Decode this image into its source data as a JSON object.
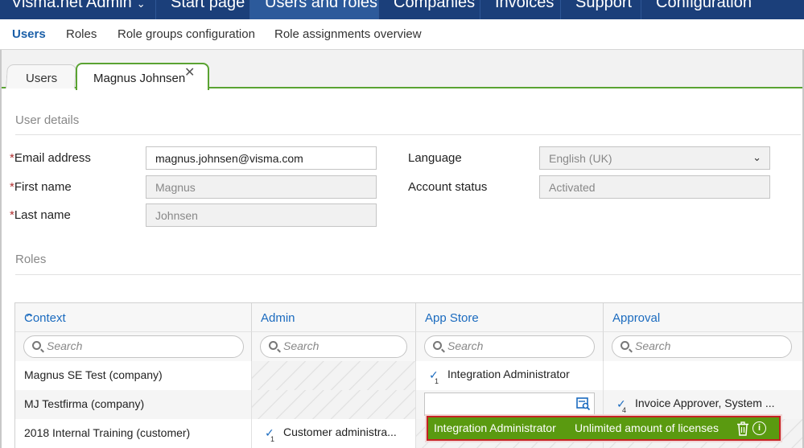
{
  "topnav": {
    "brand": "Visma.net Admin",
    "items": [
      {
        "label": "Start page"
      },
      {
        "label": "Users and roles"
      },
      {
        "label": "Companies"
      },
      {
        "label": "Invoices"
      },
      {
        "label": "Support"
      },
      {
        "label": "Configuration"
      }
    ]
  },
  "subnav": {
    "items": [
      {
        "label": "Users"
      },
      {
        "label": "Roles"
      },
      {
        "label": "Role groups configuration"
      },
      {
        "label": "Role assignments overview"
      }
    ]
  },
  "tabs": [
    {
      "label": "Users"
    },
    {
      "label": "Magnus Johnsen"
    }
  ],
  "user_details": {
    "title": "User details",
    "email": {
      "label": "Email address",
      "value": "magnus.johnsen@visma.com"
    },
    "first_name": {
      "label": "First name",
      "value": "Magnus"
    },
    "last_name": {
      "label": "Last name",
      "value": "Johnsen"
    },
    "language": {
      "label": "Language",
      "value": "English (UK)"
    },
    "account_status": {
      "label": "Account status",
      "value": "Activated"
    }
  },
  "roles": {
    "title": "Roles",
    "columns": [
      {
        "label": "Context"
      },
      {
        "label": "Admin"
      },
      {
        "label": "App Store"
      },
      {
        "label": "Approval"
      }
    ],
    "search_placeholder": "Search",
    "rows": [
      {
        "context": "Magnus SE Test (company)",
        "app_store": {
          "count": "1",
          "name": "Integration Administrator"
        }
      },
      {
        "context": "MJ Testfirma (company)",
        "approval": {
          "count": "4",
          "name": "Invoice Approver, System ..."
        }
      },
      {
        "context": "2018 Internal Training (customer)",
        "admin": {
          "count": "1",
          "name": "Customer administra..."
        }
      }
    ]
  },
  "tooltip": {
    "role": "Integration Administrator",
    "license": "Unlimited amount of licenses"
  },
  "colors": {
    "nav_bg": "#1b3f7a",
    "link_blue": "#1b6bbf",
    "tab_green": "#5aa332",
    "tooltip_green": "#5a9a10",
    "highlight_red": "#c52222"
  }
}
